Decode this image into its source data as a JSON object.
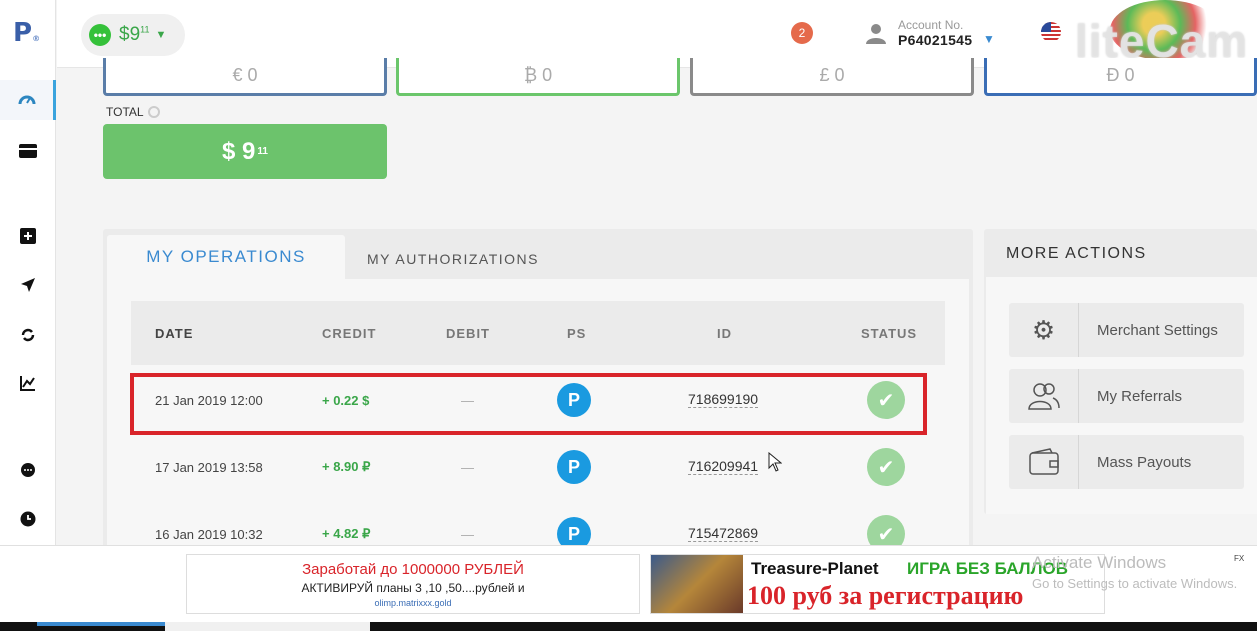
{
  "sidebar": {
    "logo": "P",
    "logo_mark": "®",
    "items": [
      {
        "name": "dashboard",
        "icon": "speedometer-icon"
      },
      {
        "name": "wallet",
        "icon": "card-icon"
      },
      {
        "name": "add-funds",
        "icon": "plus-box-icon"
      },
      {
        "name": "send",
        "icon": "paper-plane-icon"
      },
      {
        "name": "exchange",
        "icon": "refresh-icon"
      },
      {
        "name": "statistics",
        "icon": "chart-icon"
      },
      {
        "name": "chat",
        "icon": "chat-bubble-icon"
      },
      {
        "name": "history",
        "icon": "clock-icon"
      }
    ]
  },
  "topbar": {
    "balance_main": "$9",
    "balance_cents": "11",
    "notifications": "2",
    "account_label": "Account No.",
    "account_number": "P64021545",
    "watermark": "liteCam"
  },
  "currencies": [
    {
      "symbol": "€ 0"
    },
    {
      "symbol": "₿ 0"
    },
    {
      "symbol": "£ 0"
    },
    {
      "symbol": "Đ 0"
    }
  ],
  "total": {
    "label": "TOTAL",
    "amount": "$ 9",
    "cents": "11"
  },
  "operations": {
    "tabs": [
      "MY OPERATIONS",
      "MY AUTHORIZATIONS"
    ],
    "columns": [
      "DATE",
      "CREDIT",
      "DEBIT",
      "PS",
      "ID",
      "STATUS"
    ],
    "rows": [
      {
        "date": "21 Jan 2019 12:00",
        "credit": "+ 0.22 $",
        "debit": "—",
        "ps": "P",
        "id": "718699190"
      },
      {
        "date": "17 Jan 2019 13:58",
        "credit": "+ 8.90 ₽",
        "debit": "—",
        "ps": "P",
        "id": "716209941"
      },
      {
        "date": "16 Jan 2019 10:32",
        "credit": "+ 4.82 ₽",
        "debit": "—",
        "ps": "P",
        "id": "715472869"
      }
    ]
  },
  "more_actions": {
    "title": "MORE ACTIONS",
    "items": [
      "Merchant Settings",
      "My Referrals",
      "Mass Payouts"
    ]
  },
  "ads": {
    "left_title": "Заработай до 1000000 РУБЛЕЙ",
    "left_text": "АКТИВИРУЙ планы 3 ,10 ,50....рублей и",
    "left_url": "olimp.matrixxx.gold",
    "right_brand": "Treasure-Planet",
    "right_tag": "ИГРА БЕЗ БАЛЛОВ",
    "right_offer": "100 руб за регистрацию"
  },
  "os_overlay": {
    "activate_title": "Activate Windows",
    "activate_text": "Go to Settings to activate Windows.",
    "fx": "FX"
  }
}
